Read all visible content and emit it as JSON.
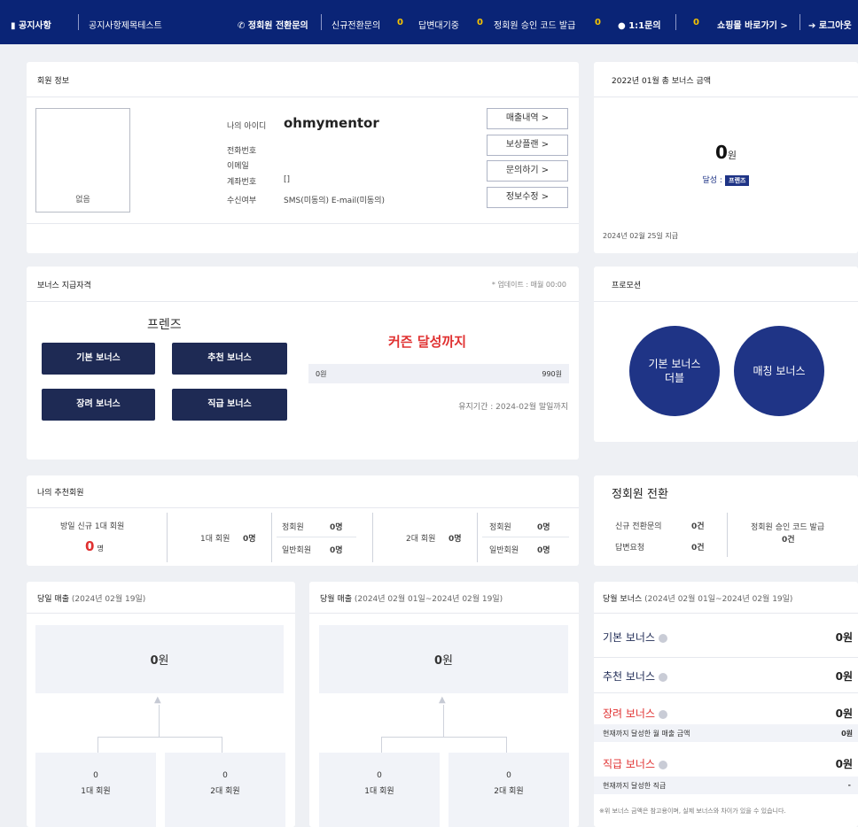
{
  "topbar": {
    "notice_label": "공지사항",
    "notice_title": "공지사항제목테스트",
    "regular_inquiry": "정회원 전환문의",
    "new_inquiry": "신규전환문의",
    "new_inquiry_count": "0",
    "waiting": "답변대기중",
    "waiting_count": "0",
    "code_issue": "정회원 승인 코드 발급",
    "code_issue_count": "0",
    "one_on_one": "1:1문의",
    "one_on_one_count": "0",
    "mall": "쇼핑몰 바로가기 >",
    "logout": "로그아웃"
  },
  "member": {
    "title": "회원 정보",
    "photo_label": "없음",
    "id_label": "나의 아이디",
    "id_value": "ohmymentor",
    "phone_label": "전화번호",
    "email_label": "이메일",
    "account_label": "계좌번호",
    "account_value": "[]",
    "receive_label": "수신여부",
    "receive_value": "SMS(미동의) E-mail(미동의)",
    "buttons": [
      "매출내역 >",
      "보상플랜 >",
      "문의하기 >",
      "정보수정 >"
    ]
  },
  "monthly_bonus": {
    "title": "2022년 01월 총 보너스 금액",
    "amount": "0",
    "unit": "원",
    "achieve_label": "달성 :",
    "achieve_badge": "프렌즈",
    "date_note": "2024년 02월 25일 지급"
  },
  "qualification": {
    "title": "보너스 지급자격",
    "update_note": "* 업데이트 : 매월 00:00",
    "level": "프렌즈",
    "buttons": [
      "기본 보너스",
      "추천 보너스",
      "장려 보너스",
      "직급 보너스"
    ],
    "target": "커즌 달성까지",
    "progress_start": "0원",
    "progress_end": "990원",
    "progress_fraction": 0,
    "period": "유지기간 : 2024-02월 말일까지"
  },
  "promotion": {
    "title": "프로모션",
    "circle1": "기본 보너스\n더블",
    "circle2": "매칭 보너스"
  },
  "referrals": {
    "title": "나의 추천회원",
    "today_label": "방일 신규 1대 회원",
    "today_value": "0",
    "today_unit": "명",
    "gen1_label": "1대 회원",
    "gen1_value": "0명",
    "gen1_regular_label": "정회원",
    "gen1_regular_value": "0명",
    "gen1_normal_label": "일반회원",
    "gen1_normal_value": "0명",
    "gen2_label": "2대 회원",
    "gen2_value": "0명",
    "gen2_regular_label": "정회원",
    "gen2_regular_value": "0명",
    "gen2_normal_label": "일반회원",
    "gen2_normal_value": "0명"
  },
  "conversion": {
    "title": "정회원 전환",
    "new_label": "신규 전환문의",
    "new_value": "0건",
    "reply_label": "답변요청",
    "reply_value": "0건",
    "code_label": "정회원 승인 코드 발급",
    "code_value": "0건"
  },
  "daily_sales": {
    "title": "당일 매출",
    "period": "(2024년 02월 19일)",
    "total": "0",
    "unit": "원",
    "left_value": "0",
    "left_label": "1대 회원",
    "right_value": "0",
    "right_label": "2대 회원"
  },
  "monthly_sales": {
    "title": "당월 매출",
    "period": "(2024년 02월 01일~2024년 02월 19일)",
    "total": "0",
    "unit": "원",
    "left_value": "0",
    "left_label": "1대 회원",
    "right_value": "0",
    "right_label": "2대 회원"
  },
  "monthly_bonus_detail": {
    "title": "당월 보너스",
    "period": "(2024년 02월 01일~2024년 02월 19일)",
    "basic": "기본 보너스",
    "basic_value": "0원",
    "referral": "추천 보너스",
    "referral_value": "0원",
    "encourage": "장려 보너스",
    "encourage_value": "0원",
    "encourage_sub": "현재까지 달성한 월 매출 금액",
    "encourage_sub_value": "0원",
    "rank": "직급 보너스",
    "rank_value": "0원",
    "rank_sub": "현재까지 달성한 직급",
    "rank_sub_value": "-",
    "footnote": "※위 보너스 금액은 참고용이며, 실제 보너스와 차이가 있을 수 있습니다."
  },
  "colors": {
    "navy": "#0a2476",
    "button_navy": "#1e2a54",
    "circle_blue": "#1f3486",
    "accent_red": "#e03131",
    "yellow": "#f6c300"
  }
}
